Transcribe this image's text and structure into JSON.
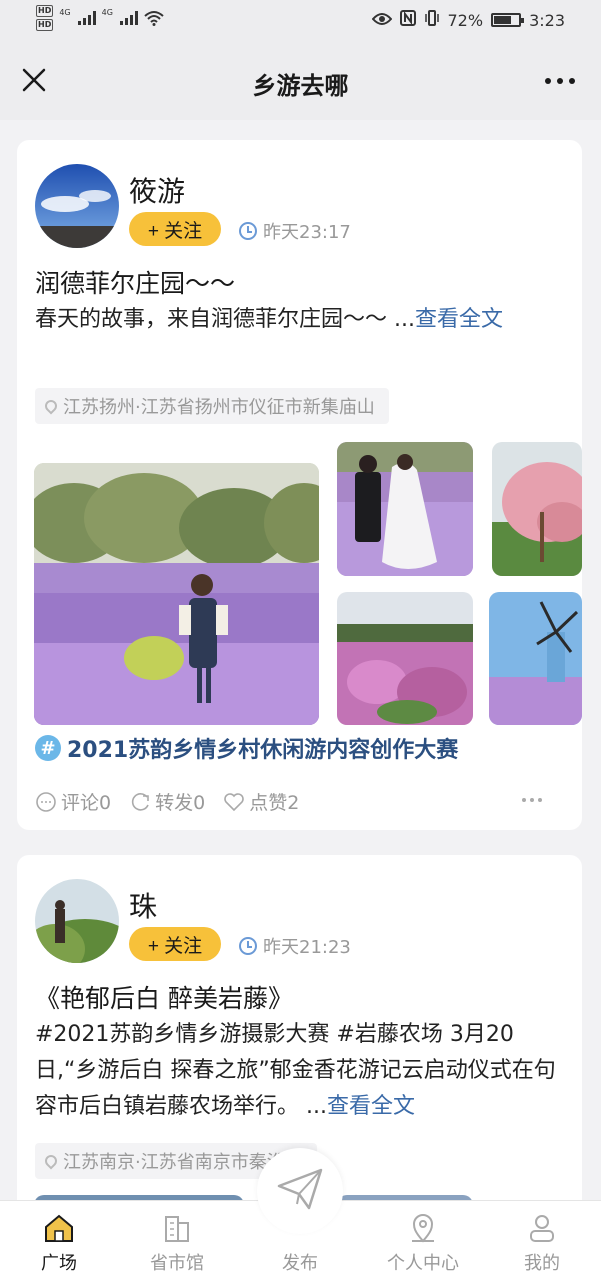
{
  "status_bar": {
    "hd_label": "HD",
    "signal_label": "4G",
    "battery": "72%",
    "battery_level": 0.72,
    "time": "3:23"
  },
  "header": {
    "title": "乡游去哪"
  },
  "posts": [
    {
      "username": "筱游",
      "follow_label": "+ 关注",
      "time": "昨天23:17",
      "title": "润德菲尔庄园〜〜",
      "body": "春天的故事，来自润德菲尔庄园〜〜 ...",
      "read_more": "查看全文",
      "location": "江苏扬州·江苏省扬州市仪征市新集庙山",
      "topic": "2021苏韵乡情乡村休闲游内容创作大赛",
      "actions": {
        "comment": "评论0",
        "share": "转发0",
        "like": "点赞2"
      }
    },
    {
      "username": "珠",
      "follow_label": "+ 关注",
      "time": "昨天21:23",
      "title": "《艳郁后白 醉美岩藤》",
      "body": "#2021苏韵乡情乡游摄影大赛 #岩藤农场 3月20日,“乡游后白 探春之旅”郁金香花游记云启动仪式在句容市后白镇岩藤农场举行。 ...",
      "read_more": "查看全文",
      "location": "江苏南京·江苏省南京市秦淮区"
    }
  ],
  "bottom_nav": {
    "items": [
      {
        "label": "广场",
        "icon": "home-icon",
        "active": true
      },
      {
        "label": "省市馆",
        "icon": "building-icon",
        "active": false
      },
      {
        "label": "发布",
        "icon": "paper-plane-icon",
        "active": false
      },
      {
        "label": "个人中心",
        "icon": "location-pin-icon",
        "active": false
      },
      {
        "label": "我的",
        "icon": "user-icon",
        "active": false
      }
    ]
  },
  "colors": {
    "follow_button": "#f7c13a",
    "read_more": "#3a6aa8",
    "topic": "#2b4f80",
    "home_active": "#e8b13a"
  }
}
